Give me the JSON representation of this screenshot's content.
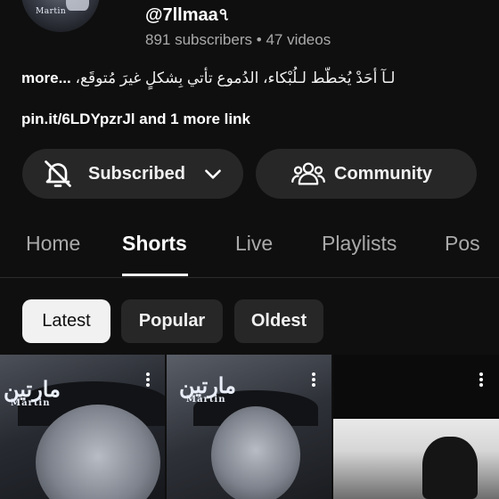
{
  "channel": {
    "avatar_caption": "Martin",
    "handle": "@7llmaa৭",
    "subscribers": "891 subscribers",
    "separator": "•",
    "videos": "47 videos",
    "description_more": "more...",
    "description": "لـآ أحَدْ يُخطّط لـلُبْكاء، الدُموع تأتي بِشكلٍ غيرَ مُتوقَع،",
    "links": "pin.it/6LDYpzrJl and 1 more link"
  },
  "actions": {
    "subscribe_label": "Subscribed",
    "community_label": "Community"
  },
  "tabs": [
    {
      "label": "Home"
    },
    {
      "label": "Shorts"
    },
    {
      "label": "Live"
    },
    {
      "label": "Playlists"
    },
    {
      "label": "Pos"
    }
  ],
  "active_tab": "Shorts",
  "filters": [
    {
      "label": "Latest",
      "selected": true
    },
    {
      "label": "Popular",
      "selected": false
    },
    {
      "label": "Oldest",
      "selected": false
    }
  ],
  "shorts": [
    {
      "watermark_ar": "مارتين",
      "watermark_en": "Martin"
    },
    {
      "watermark_ar": "مارتين",
      "watermark_en": "Martin"
    },
    {}
  ],
  "colors": {
    "background": "#0f0f0f",
    "button_bg": "#272727",
    "text_primary": "#f1f1f1",
    "text_secondary": "#aaaaaa",
    "chip_selected_bg": "#f1f1f1"
  },
  "icons": {
    "subscribed": "bell-off-icon",
    "dropdown": "chevron-down-icon",
    "community": "people-icon",
    "more": "more-vert-icon"
  }
}
